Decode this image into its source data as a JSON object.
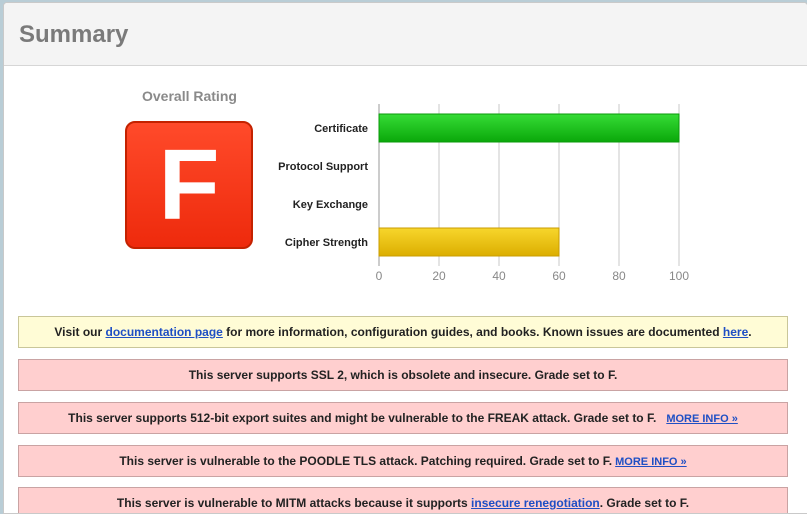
{
  "summary": {
    "title": "Summary",
    "overall_label": "Overall Rating",
    "grade": "F"
  },
  "chart_data": {
    "type": "bar",
    "orientation": "horizontal",
    "categories": [
      "Certificate",
      "Protocol Support",
      "Key Exchange",
      "Cipher Strength"
    ],
    "values": [
      100,
      0,
      0,
      60
    ],
    "colors": [
      "#1cc11c",
      "",
      "",
      "#f1c40f"
    ],
    "xlim": [
      0,
      100
    ],
    "ticks": [
      "0",
      "20",
      "40",
      "60",
      "80",
      "100"
    ],
    "grid": true
  },
  "messages": {
    "info": {
      "pre": "Visit our ",
      "link1": "documentation page",
      "mid": " for more information, configuration guides, and books. Known issues are documented ",
      "link2": "here",
      "post": "."
    },
    "ssl2": "This server supports SSL 2, which is obsolete and insecure. Grade set to F.",
    "freak": "This server supports 512-bit export suites and might be vulnerable to the FREAK attack. Grade set to F.",
    "freak_more": "MORE INFO »",
    "poodle": "This server is vulnerable to the POODLE TLS attack. Patching required. Grade set to F.",
    "poodle_more": "MORE INFO »",
    "mitm_pre": "This server is vulnerable to MITM attacks because it supports ",
    "mitm_link": "insecure renegotiation",
    "mitm_post": ". Grade set to F."
  }
}
